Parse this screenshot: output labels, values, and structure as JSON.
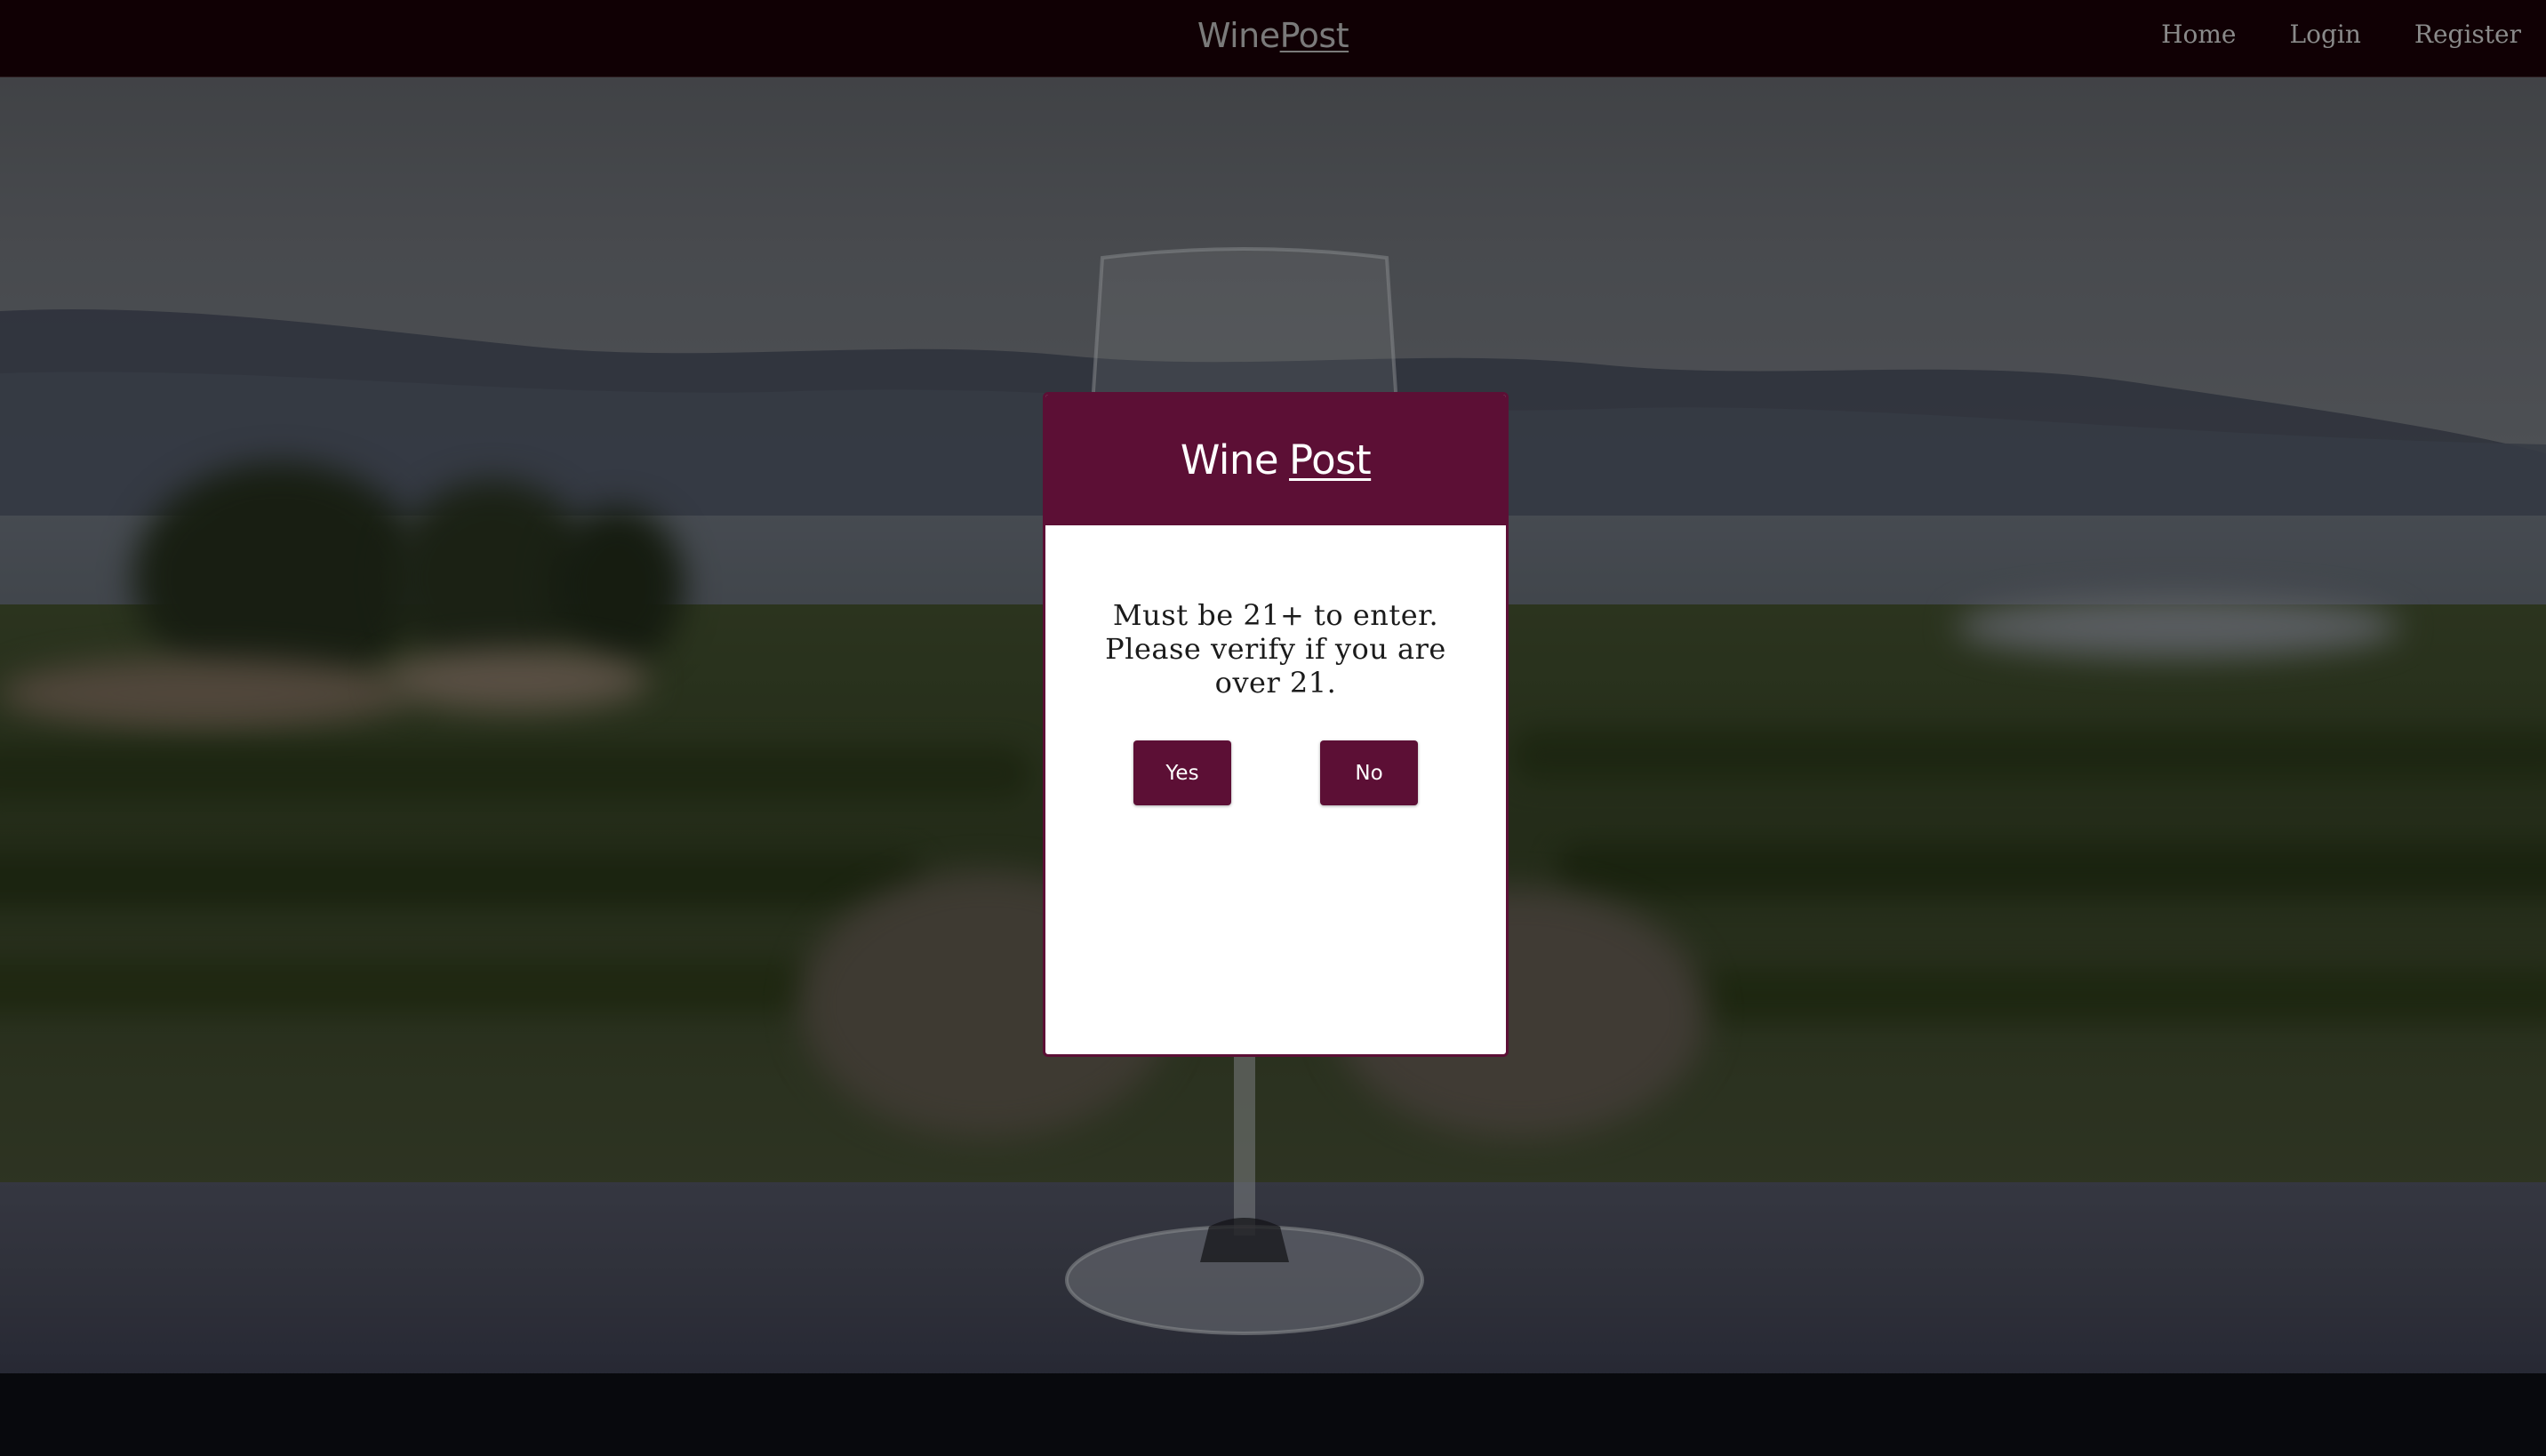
{
  "navbar": {
    "brand_first": "Wine",
    "brand_second": "Post",
    "links": [
      "Home",
      "Login",
      "Register"
    ]
  },
  "modal": {
    "title_first": "Wine",
    "title_second": "Post",
    "message": "Must be 21+ to enter. Please verify if you are over 21.",
    "yes_label": "Yes",
    "no_label": "No"
  },
  "colors": {
    "brand_wine": "#5c0f35",
    "navbar_bg": "#100004",
    "nav_text": "#8a8a8a"
  }
}
